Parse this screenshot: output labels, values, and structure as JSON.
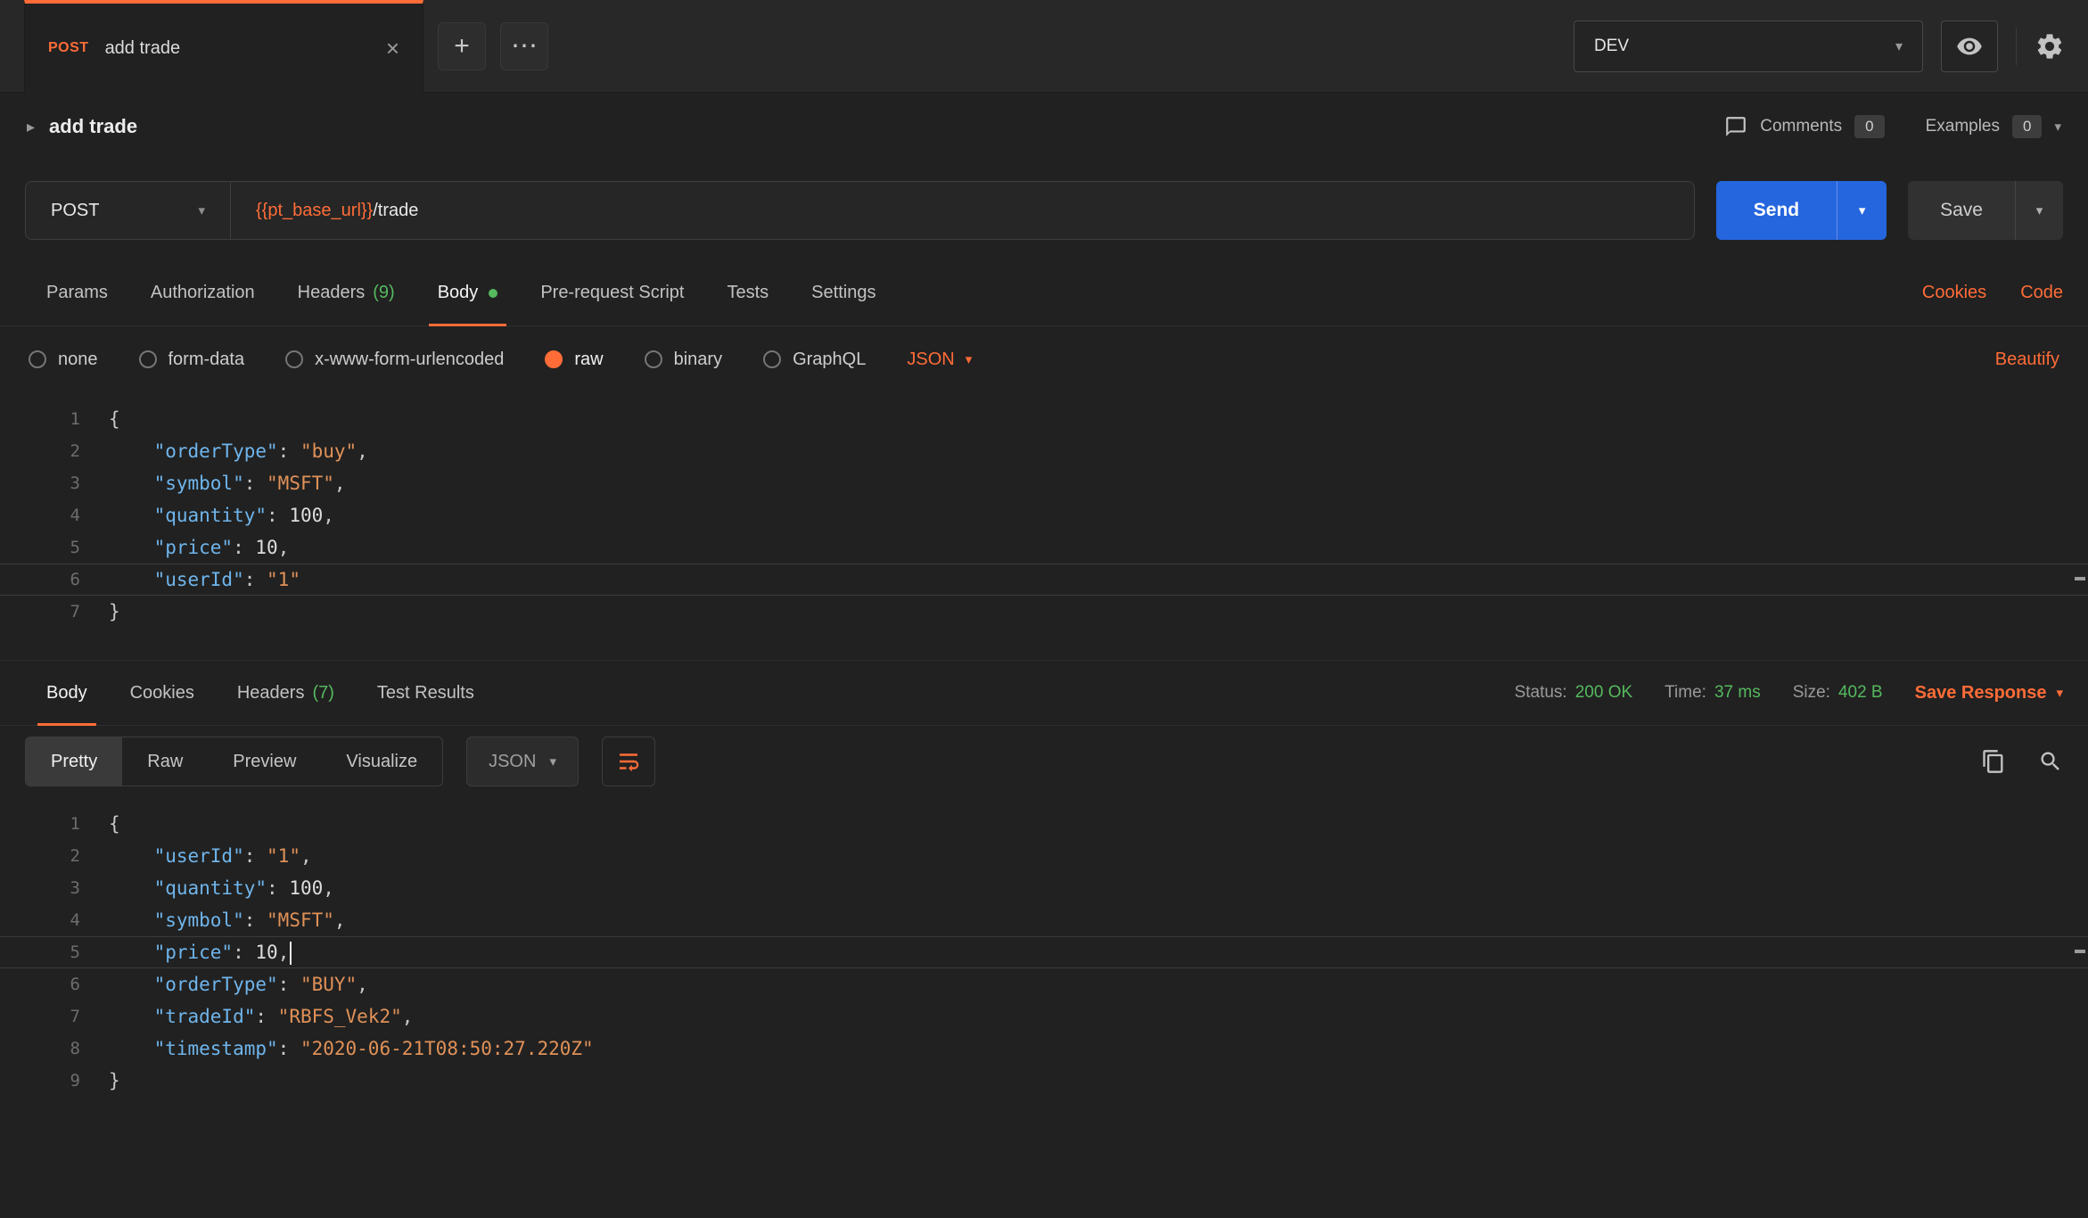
{
  "colors": {
    "accent": "#ff6c37",
    "send-blue": "#2566df",
    "success-green": "#55b95e",
    "tok-key": "#6fb5ec",
    "tok-string": "#e09158",
    "tok-number": "#dddddd",
    "tok-plain": "#c9c9c9"
  },
  "icons": {
    "close": "×",
    "plus": "+",
    "more": "⋯",
    "caret_down": "▾",
    "caret_right": "▸"
  },
  "topbar": {
    "tab": {
      "method": "POST",
      "title": "add trade"
    },
    "environment": {
      "selected": "DEV"
    }
  },
  "request_header": {
    "title": "add trade",
    "comments_label": "Comments",
    "comments_count": "0",
    "examples_label": "Examples",
    "examples_count": "0"
  },
  "url_bar": {
    "method": "POST",
    "url_variable": "{{pt_base_url}}",
    "url_path": "/trade",
    "send_label": "Send",
    "save_label": "Save"
  },
  "request_tabs": {
    "items": [
      {
        "label": "Params"
      },
      {
        "label": "Authorization"
      },
      {
        "label": "Headers",
        "count": "(9)"
      },
      {
        "label": "Body",
        "active": true
      },
      {
        "label": "Pre-request Script"
      },
      {
        "label": "Tests"
      },
      {
        "label": "Settings"
      }
    ],
    "cookies_link": "Cookies",
    "code_link": "Code"
  },
  "body_type_bar": {
    "options": [
      {
        "label": "none"
      },
      {
        "label": "form-data"
      },
      {
        "label": "x-www-form-urlencoded"
      },
      {
        "label": "raw",
        "selected": true
      },
      {
        "label": "binary"
      },
      {
        "label": "GraphQL"
      }
    ],
    "language": "JSON",
    "beautify_link": "Beautify"
  },
  "request_editor": {
    "active_line": 6,
    "lines": [
      [
        [
          "p",
          "{"
        ]
      ],
      [
        [
          "p",
          "    "
        ],
        [
          "k",
          "\"orderType\""
        ],
        [
          "p",
          ": "
        ],
        [
          "s",
          "\"buy\""
        ],
        [
          "p",
          ","
        ]
      ],
      [
        [
          "p",
          "    "
        ],
        [
          "k",
          "\"symbol\""
        ],
        [
          "p",
          ": "
        ],
        [
          "s",
          "\"MSFT\""
        ],
        [
          "p",
          ","
        ]
      ],
      [
        [
          "p",
          "    "
        ],
        [
          "k",
          "\"quantity\""
        ],
        [
          "p",
          ": "
        ],
        [
          "n",
          "100"
        ],
        [
          "p",
          ","
        ]
      ],
      [
        [
          "p",
          "    "
        ],
        [
          "k",
          "\"price\""
        ],
        [
          "p",
          ": "
        ],
        [
          "n",
          "10"
        ],
        [
          "p",
          ","
        ]
      ],
      [
        [
          "p",
          "    "
        ],
        [
          "k",
          "\"userId\""
        ],
        [
          "p",
          ": "
        ],
        [
          "s",
          "\"1\""
        ]
      ],
      [
        [
          "p",
          "}"
        ]
      ]
    ]
  },
  "response_tabs": {
    "items": [
      {
        "label": "Body",
        "active": true
      },
      {
        "label": "Cookies"
      },
      {
        "label": "Headers",
        "count": "(7)"
      },
      {
        "label": "Test Results"
      }
    ],
    "status_label": "Status:",
    "status_value": "200 OK",
    "time_label": "Time:",
    "time_value": "37 ms",
    "size_label": "Size:",
    "size_value": "402 B",
    "save_response_label": "Save Response"
  },
  "response_toolbar": {
    "views": [
      {
        "label": "Pretty",
        "active": true
      },
      {
        "label": "Raw"
      },
      {
        "label": "Preview"
      },
      {
        "label": "Visualize"
      }
    ],
    "language": "JSON"
  },
  "response_editor": {
    "active_line": 5,
    "lines": [
      [
        [
          "p",
          "{"
        ]
      ],
      [
        [
          "p",
          "    "
        ],
        [
          "k",
          "\"userId\""
        ],
        [
          "p",
          ": "
        ],
        [
          "s",
          "\"1\""
        ],
        [
          "p",
          ","
        ]
      ],
      [
        [
          "p",
          "    "
        ],
        [
          "k",
          "\"quantity\""
        ],
        [
          "p",
          ": "
        ],
        [
          "n",
          "100"
        ],
        [
          "p",
          ","
        ]
      ],
      [
        [
          "p",
          "    "
        ],
        [
          "k",
          "\"symbol\""
        ],
        [
          "p",
          ": "
        ],
        [
          "s",
          "\"MSFT\""
        ],
        [
          "p",
          ","
        ]
      ],
      [
        [
          "p",
          "    "
        ],
        [
          "k",
          "\"price\""
        ],
        [
          "p",
          ": "
        ],
        [
          "n",
          "10"
        ],
        [
          "p",
          ","
        ],
        [
          "c",
          ""
        ]
      ],
      [
        [
          "p",
          "    "
        ],
        [
          "k",
          "\"orderType\""
        ],
        [
          "p",
          ": "
        ],
        [
          "s",
          "\"BUY\""
        ],
        [
          "p",
          ","
        ]
      ],
      [
        [
          "p",
          "    "
        ],
        [
          "k",
          "\"tradeId\""
        ],
        [
          "p",
          ": "
        ],
        [
          "s",
          "\"RBFS_Vek2\""
        ],
        [
          "p",
          ","
        ]
      ],
      [
        [
          "p",
          "    "
        ],
        [
          "k",
          "\"timestamp\""
        ],
        [
          "p",
          ": "
        ],
        [
          "s",
          "\"2020-06-21T08:50:27.220Z\""
        ]
      ],
      [
        [
          "p",
          "}"
        ]
      ]
    ]
  }
}
